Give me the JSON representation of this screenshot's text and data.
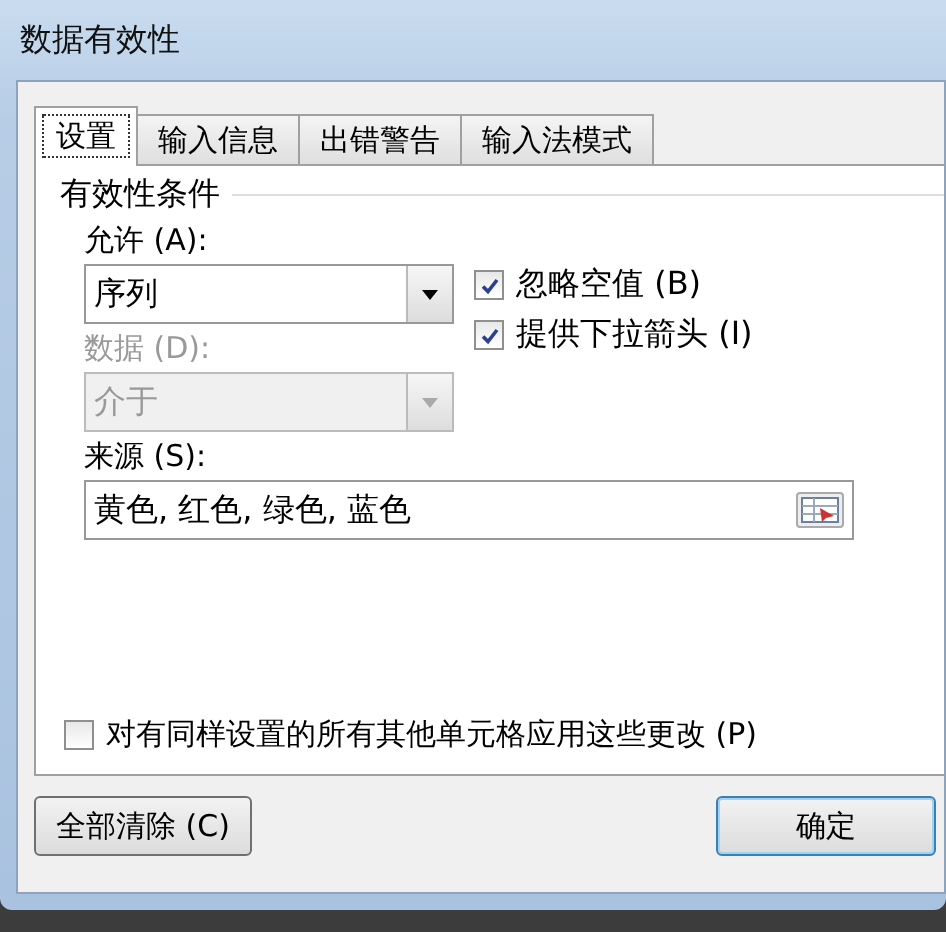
{
  "window": {
    "title": "数据有效性"
  },
  "tabs": [
    {
      "label": "设置",
      "selected": true
    },
    {
      "label": "输入信息",
      "selected": false
    },
    {
      "label": "出错警告",
      "selected": false
    },
    {
      "label": "输入法模式",
      "selected": false
    }
  ],
  "group_title": "有效性条件",
  "allow": {
    "label": "允许 (A):",
    "value": "序列",
    "disabled": false
  },
  "data": {
    "label": "数据 (D):",
    "value": "介于",
    "disabled": true
  },
  "options": [
    {
      "label": "忽略空值 (B)",
      "checked": true
    },
    {
      "label": "提供下拉箭头 (I)",
      "checked": true
    }
  ],
  "source": {
    "label": "来源 (S):",
    "value": "黄色, 红色, 绿色, 蓝色"
  },
  "apply_all": {
    "label": "对有同样设置的所有其他单元格应用这些更改 (P)",
    "checked": false
  },
  "buttons": [
    {
      "label": "全部清除 (C)",
      "kind": "secondary"
    },
    {
      "label": "确定",
      "kind": "default"
    }
  ]
}
